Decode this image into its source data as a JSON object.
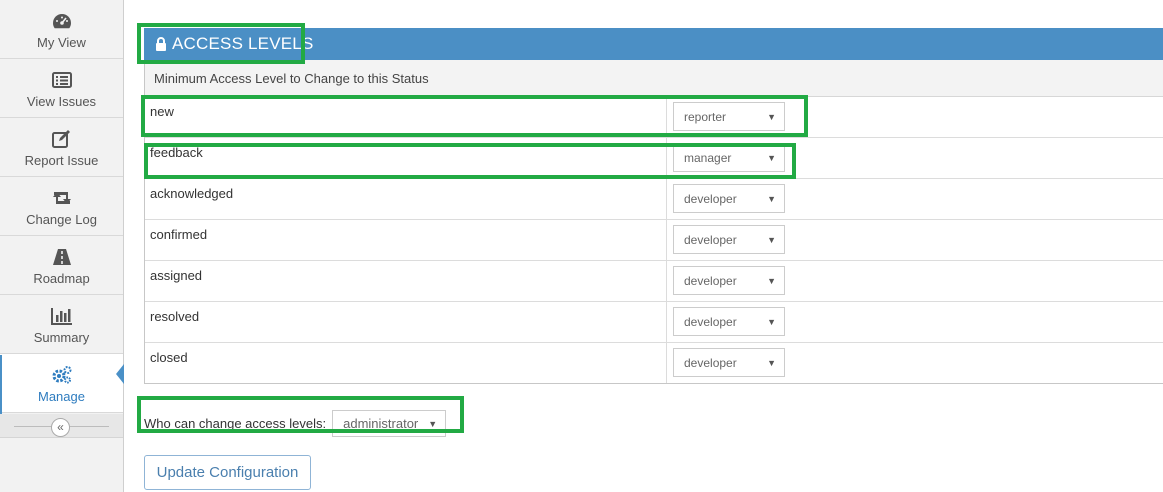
{
  "sidebar": {
    "items": [
      {
        "label": "My View",
        "icon": "tachometer-icon"
      },
      {
        "label": "View Issues",
        "icon": "list-icon"
      },
      {
        "label": "Report Issue",
        "icon": "edit-icon"
      },
      {
        "label": "Change Log",
        "icon": "retweet-icon"
      },
      {
        "label": "Roadmap",
        "icon": "road-icon"
      },
      {
        "label": "Summary",
        "icon": "bar-chart-icon"
      },
      {
        "label": "Manage",
        "icon": "gears-icon",
        "active": true
      }
    ],
    "collapse_glyph": "«"
  },
  "section": {
    "title": "ACCESS LEVELS",
    "subheader": "Minimum Access Level to Change to this Status"
  },
  "rows": [
    {
      "status": "new",
      "level": "reporter"
    },
    {
      "status": "feedback",
      "level": "manager"
    },
    {
      "status": "acknowledged",
      "level": "developer"
    },
    {
      "status": "confirmed",
      "level": "developer"
    },
    {
      "status": "assigned",
      "level": "developer"
    },
    {
      "status": "resolved",
      "level": "developer"
    },
    {
      "status": "closed",
      "level": "developer"
    }
  ],
  "footer": {
    "who_label": "Who can change access levels:",
    "who_value": "administrator",
    "update_button": "Update Configuration"
  },
  "colors": {
    "header_blue": "#4b8fc5",
    "highlight_green": "#22aa44",
    "active_blue": "#2e7cbf"
  },
  "dropdown_arrow": "▼"
}
